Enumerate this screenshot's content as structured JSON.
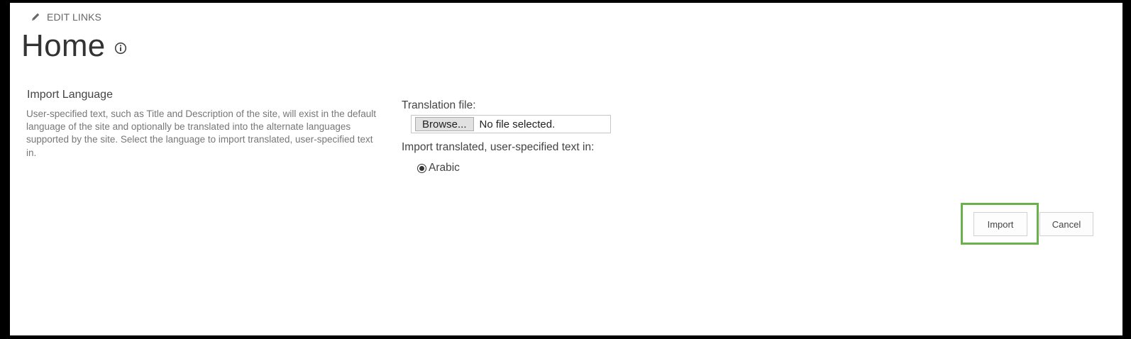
{
  "header": {
    "edit_links_label": "EDIT LINKS",
    "edit_icon": "pencil-icon",
    "page_title": "Home",
    "info_icon": "info-icon"
  },
  "import_section": {
    "title": "Import Language",
    "description": "User-specified text, such as Title and Description of the site, will exist in the default language of the site and optionally be translated into the alternate languages supported by the site. Select the language to import translated, user-specified text in."
  },
  "form": {
    "translation_file_label": "Translation file:",
    "browse_label": "Browse...",
    "file_status": "No file selected.",
    "import_text_label": "Import translated, user-specified text in:",
    "languages": [
      {
        "label": "Arabic",
        "selected": true
      }
    ]
  },
  "actions": {
    "import_label": "Import",
    "cancel_label": "Cancel",
    "highlight_color": "#6ab04c"
  }
}
